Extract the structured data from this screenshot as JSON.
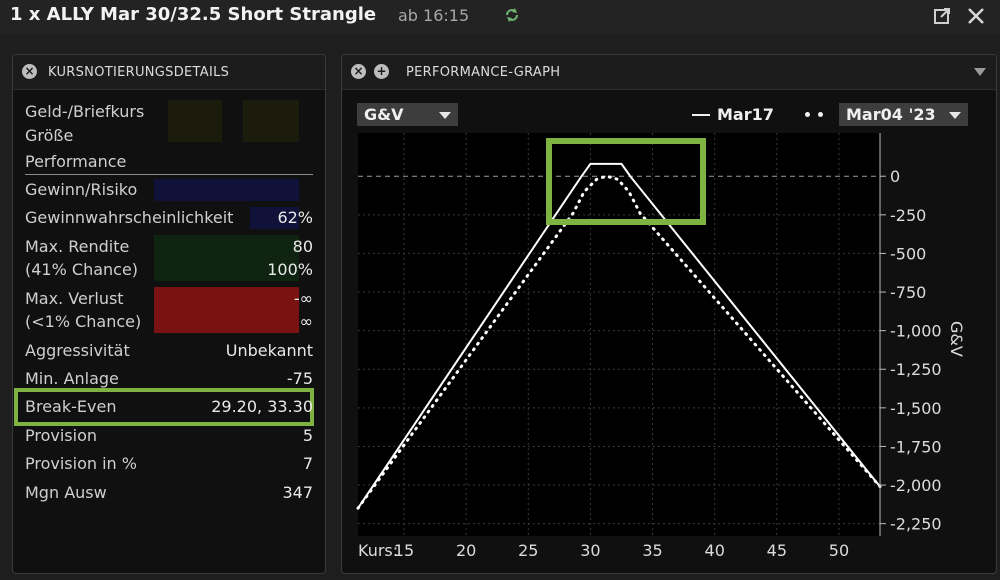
{
  "window": {
    "title": "1 x ALLY Mar 30/32.5 Short Strangle",
    "time_label": "ab 16:15"
  },
  "left_panel": {
    "header": "KURSNOTIERUNGSDETAILS",
    "rows": {
      "bid_ask": {
        "label": "Geld-/Briefkurs"
      },
      "size": {
        "label": "Größe"
      },
      "performance": {
        "label": "Performance"
      },
      "profit_risk": {
        "label": "Gewinn/Risiko"
      },
      "prob_profit": {
        "label": "Gewinnwahrscheinlichkeit",
        "value": "62%"
      },
      "max_return": {
        "label": "Max. Rendite",
        "value": "80",
        "sub_label": "(41% Chance)",
        "sub_value": "100%"
      },
      "max_loss": {
        "label": "Max. Verlust",
        "value": "-∞",
        "sub_label": "(<1% Chance)",
        "sub_value": "∞"
      },
      "aggressiveness": {
        "label": "Aggressivität",
        "value": "Unbekannt"
      },
      "min_investment": {
        "label": "Min. Anlage",
        "value": "-75"
      },
      "break_even": {
        "label": "Break-Even",
        "value": "29.20, 33.30"
      },
      "commission": {
        "label": "Provision",
        "value": "5"
      },
      "commission_pct": {
        "label": "Provision in %",
        "value": "7"
      },
      "margin_impact": {
        "label": "Mgn Ausw",
        "value": "347"
      }
    }
  },
  "right_panel": {
    "header": "PERFORMANCE-GRAPH",
    "metric_dropdown": "G&V",
    "legend_solid": "Mar17",
    "date_dropdown": "Mar04 '23",
    "x_axis_prefix": "Kurs:",
    "y_axis_title": "G&V"
  },
  "chart_data": {
    "type": "line",
    "x_ticks": [
      15,
      20,
      25,
      30,
      35,
      40,
      45,
      50
    ],
    "y_ticks": [
      0,
      -250,
      -500,
      -750,
      -1000,
      -1250,
      -1500,
      -1750,
      -2000,
      -2250
    ],
    "y_tick_labels": [
      "0",
      "-250",
      "-500",
      "-750",
      "-1,000",
      "-1,250",
      "-1,500",
      "-1,750",
      "-2,000",
      "-2,250"
    ],
    "xlim": [
      11.3,
      53.3
    ],
    "ylim": [
      -2330,
      280
    ],
    "grid": true,
    "series": [
      {
        "name": "Mar17",
        "style": "solid",
        "x": [
          11.3,
          29.2,
          30,
          32.5,
          33.3,
          53.3
        ],
        "y": [
          -2150,
          -10,
          80,
          80,
          -10,
          -2010
        ]
      },
      {
        "name": "Mar04 '23",
        "style": "dotted",
        "x": [
          11.3,
          28.6,
          29.5,
          30.5,
          31.3,
          32.2,
          33.1,
          34.0,
          53.3
        ],
        "y": [
          -2150,
          -240,
          -100,
          -20,
          0,
          -20,
          -100,
          -240,
          -2010
        ]
      }
    ]
  },
  "colors": {
    "profit_bg": "#0f2410",
    "loss_bg": "#7a1212",
    "navy_bg": "#10123a",
    "highlight": "#7fb341"
  }
}
